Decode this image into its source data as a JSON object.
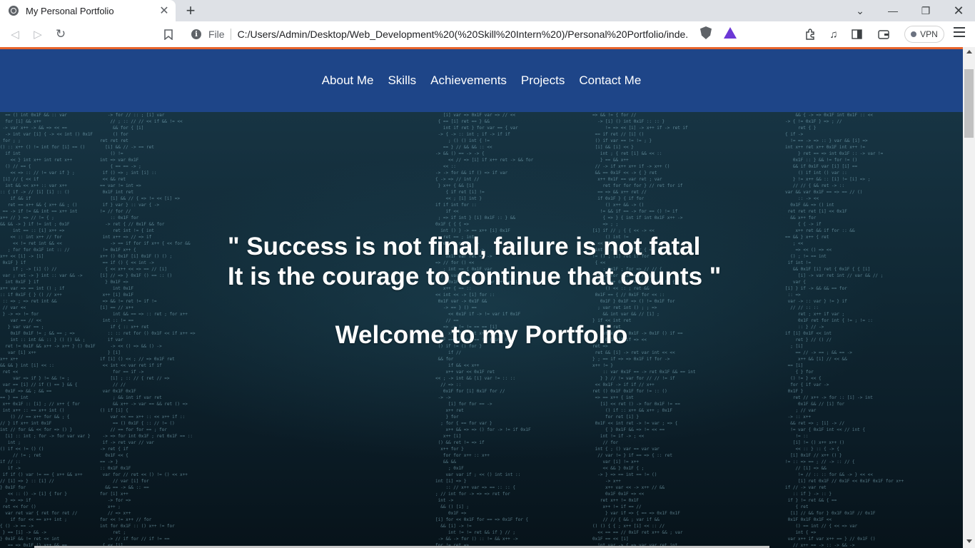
{
  "browser": {
    "tab_title": "My Personal Portfolio",
    "tab_close": "✕",
    "new_tab": "+",
    "address_scheme": "File",
    "address_url": "C:/Users/Admin/Desktop/Web_Development%20(%20Skill%20Intern%20)/Personal%20Portfolio/inde...",
    "vpn_label": "VPN"
  },
  "nav": {
    "items": [
      {
        "label": "About Me"
      },
      {
        "label": "Skills"
      },
      {
        "label": "Achievements"
      },
      {
        "label": "Projects"
      },
      {
        "label": "Contact Me"
      }
    ]
  },
  "hero": {
    "quote_line1": "\" Success is not final, failure is not fatal",
    "quote_line2": "It is the courage to continue that counts \"",
    "welcome": "Welcome to my Portfolio"
  },
  "colors": {
    "navbar": "#1e4588",
    "accent_line": "#e8642c",
    "hero_text": "#ffffff"
  }
}
